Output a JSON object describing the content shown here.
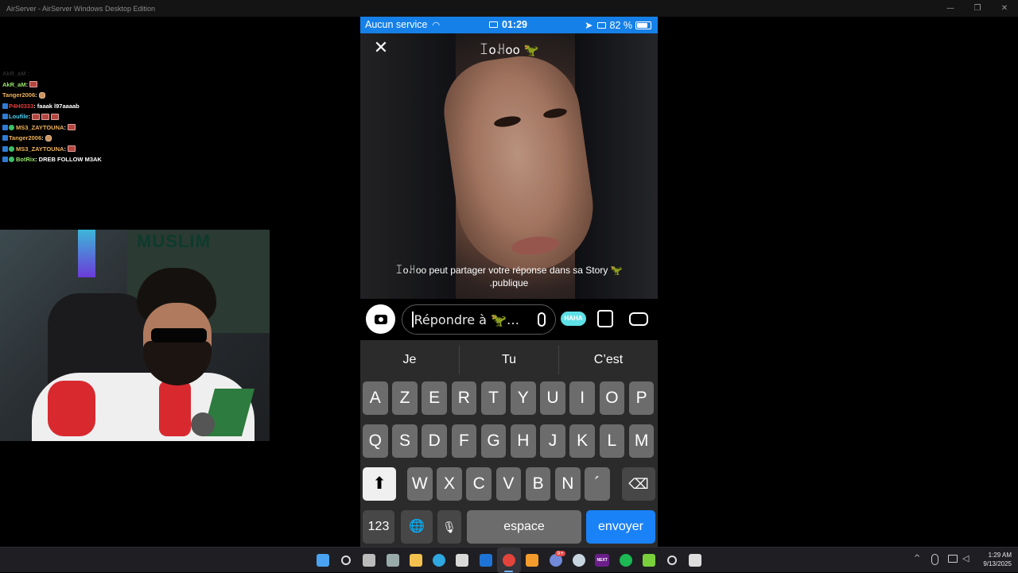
{
  "window": {
    "title": "AirServer - AirServer Windows Desktop Edition",
    "controls": {
      "minimize": "—",
      "restore": "❐",
      "close": "✕"
    }
  },
  "chat": {
    "lines": [
      {
        "user": "AkR_aM",
        "color": "#9be86c",
        "msg": "",
        "emotes": 1
      },
      {
        "user": "Tanger2006",
        "color": "#f0b25a",
        "msg": "",
        "emotes": 1
      },
      {
        "user": "P4H0333",
        "color": "#e83a3a",
        "msg": "faaak l97aaaab",
        "emotes": 0
      },
      {
        "user": "Loufile",
        "color": "#4fd1f1",
        "msg": "",
        "emotes": 3
      },
      {
        "user": "MS3_ZAYTOUNA",
        "color": "#f0b25a",
        "msg": "",
        "emotes": 1
      },
      {
        "user": "Tanger2006",
        "color": "#f0b25a",
        "msg": "",
        "emotes": 1
      },
      {
        "user": "MS3_ZAYTOUNA",
        "color": "#f0b25a",
        "msg": "",
        "emotes": 1
      },
      {
        "user": "BotRix",
        "color": "#9be86c",
        "msg": "DREB FOLLOW M3AK",
        "emotes": 0
      }
    ]
  },
  "phone": {
    "status": {
      "carrier": "Aucun service",
      "time": "01:29",
      "battery": "82 %",
      "battery_level": 0.82
    },
    "story": {
      "username": "ꀤoꃅoo 🦖",
      "notice_line1": "ꀤoꃅoo peut partager votre réponse dans sa Story 🦖",
      "notice_line2": ".publique",
      "close_label": "✕"
    },
    "reply": {
      "placeholder": "Répondre à 🦖…",
      "haha_label": "HAHA"
    },
    "keyboard": {
      "suggestions": [
        "Je",
        "Tu",
        "C’est"
      ],
      "row1": [
        "A",
        "Z",
        "E",
        "R",
        "T",
        "Y",
        "U",
        "I",
        "O",
        "P"
      ],
      "row2": [
        "Q",
        "S",
        "D",
        "F",
        "G",
        "H",
        "J",
        "K",
        "L",
        "M"
      ],
      "row3": [
        "W",
        "X",
        "C",
        "V",
        "B",
        "N",
        "´"
      ],
      "shift_label": "⬆",
      "delete_label": "⌫",
      "num_label": "123",
      "globe_label": "🌐",
      "mic_label": "🎙",
      "space_label": "espace",
      "send_label": "envoyer"
    }
  },
  "taskbar": {
    "time": "1:29 AM",
    "date": "9/13/2025",
    "apps": [
      "start-icon",
      "search-icon",
      "task-view-icon",
      "settings-icon",
      "file-explorer-icon",
      "edge-icon",
      "store-icon",
      "outlook-icon",
      "chrome-icon",
      "app-a-icon",
      "discord-icon",
      "steam-icon",
      "next-icon",
      "spotify-icon",
      "green-play-icon",
      "app-clock-icon",
      "inbox-icon"
    ],
    "next_label": "NEXT",
    "discord_badge": "9+",
    "tray_chevron": "^"
  }
}
